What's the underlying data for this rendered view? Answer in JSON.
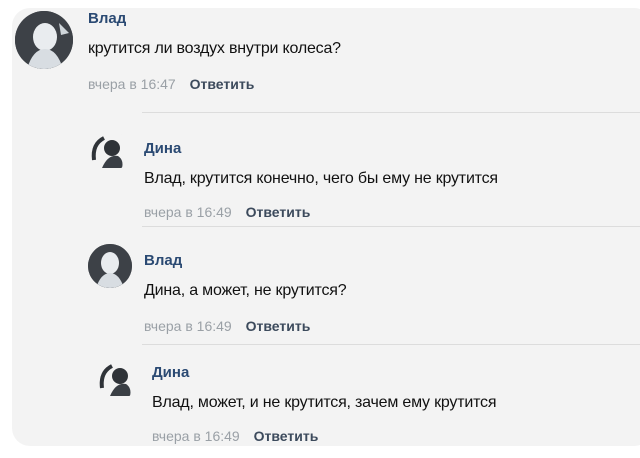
{
  "comments": [
    {
      "author": "Влад",
      "text": "крутится ли воздух внутри колеса?",
      "time": "вчера в 16:47",
      "reply_label": "Ответить"
    },
    {
      "author": "Дина",
      "text": "Влад, крутится конечно, чего бы ему не крутится",
      "time": "вчера в 16:49",
      "reply_label": "Ответить"
    },
    {
      "author": "Влад",
      "text": "Дина, а может, не крутится?",
      "time": "вчера в 16:49",
      "reply_label": "Ответить"
    },
    {
      "author": "Дина",
      "text": "Влад, может, и не крутится, зачем ему крутится",
      "time": "вчера в 16:49",
      "reply_label": "Ответить"
    }
  ],
  "colors": {
    "author_name": "#2b4a73",
    "timestamp": "#9aa0a6",
    "reply": "#3c4a5c",
    "card_bg": "#f3f3f3"
  }
}
